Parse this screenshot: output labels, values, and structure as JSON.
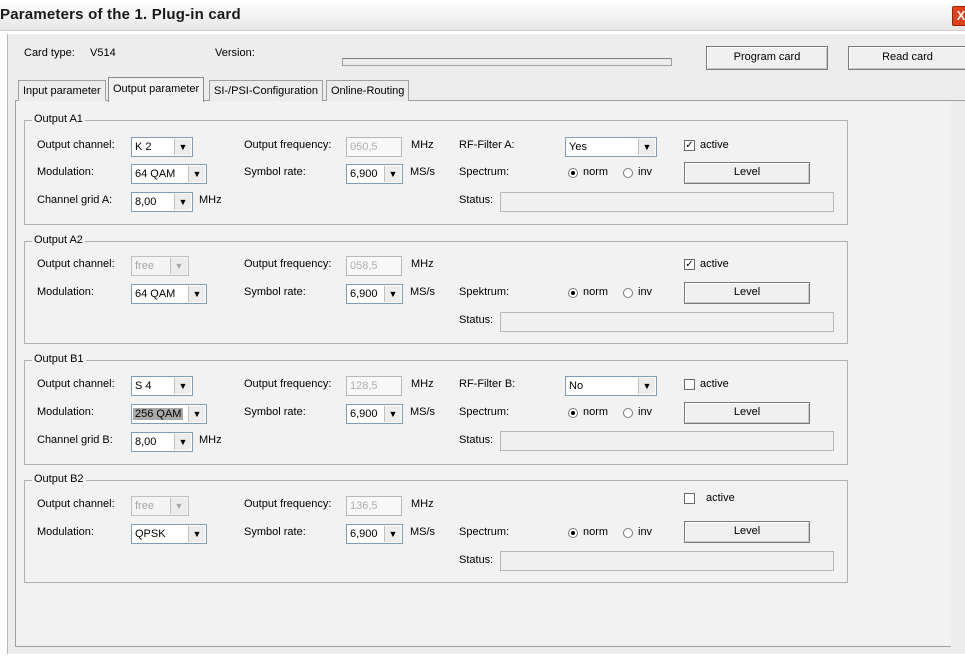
{
  "window": {
    "title": "Parameters of the 1. Plug-in card",
    "close_glyph": "X"
  },
  "header": {
    "card_type_label": "Card type:",
    "card_type_value": "V514",
    "version_label": "Version:",
    "program_card_label": "Program card",
    "read_card_label": "Read card"
  },
  "tabs": [
    {
      "label": "Input parameter",
      "active": false
    },
    {
      "label": "Output parameter",
      "active": true
    },
    {
      "label": "SI-/PSI-Configuration",
      "active": false
    },
    {
      "label": "Online-Routing",
      "active": false
    }
  ],
  "labels": {
    "output_channel": "Output channel:",
    "modulation": "Modulation:",
    "output_frequency": "Output frequency:",
    "symbol_rate": "Symbol rate:",
    "mhz": "MHz",
    "mss": "MS/s",
    "status": "Status:",
    "active": "active",
    "level": "Level",
    "norm": "norm",
    "inv": "inv"
  },
  "groups": [
    {
      "title": "Output A1",
      "output_channel": "K 2",
      "channel_enabled": true,
      "modulation": "64 QAM",
      "output_frequency": "050,5",
      "symbol_rate": "6,900",
      "rf_filter_label": "RF-Filter A:",
      "rf_filter_value": "Yes",
      "active": true,
      "spectrum_label": "Spectrum:",
      "spectrum": "norm",
      "grid_label": "Channel grid A:",
      "grid_value": "8,00"
    },
    {
      "title": "Output A2",
      "output_channel": "free",
      "channel_enabled": false,
      "modulation": "64 QAM",
      "output_frequency": "058,5",
      "symbol_rate": "6,900",
      "active": true,
      "spectrum_label": "Spektrum:",
      "spectrum": "norm"
    },
    {
      "title": "Output B1",
      "output_channel": "S 4",
      "channel_enabled": true,
      "modulation": "256 QAM",
      "output_frequency": "128,5",
      "symbol_rate": "6,900",
      "rf_filter_label": "RF-Filter B:",
      "rf_filter_value": "No",
      "active": false,
      "spectrum_label": "Spectrum:",
      "spectrum": "norm",
      "grid_label": "Channel grid B:",
      "grid_value": "8,00"
    },
    {
      "title": "Output B2",
      "output_channel": "free",
      "channel_enabled": false,
      "modulation": "QPSK",
      "output_frequency": "136,5",
      "symbol_rate": "6,900",
      "active": false,
      "spectrum_label": "Spectrum:",
      "spectrum": "norm"
    }
  ],
  "colors": {
    "close_button": "#e0401a",
    "field_border": "#7f9db9",
    "panel_bg": "#f2f2f2"
  }
}
